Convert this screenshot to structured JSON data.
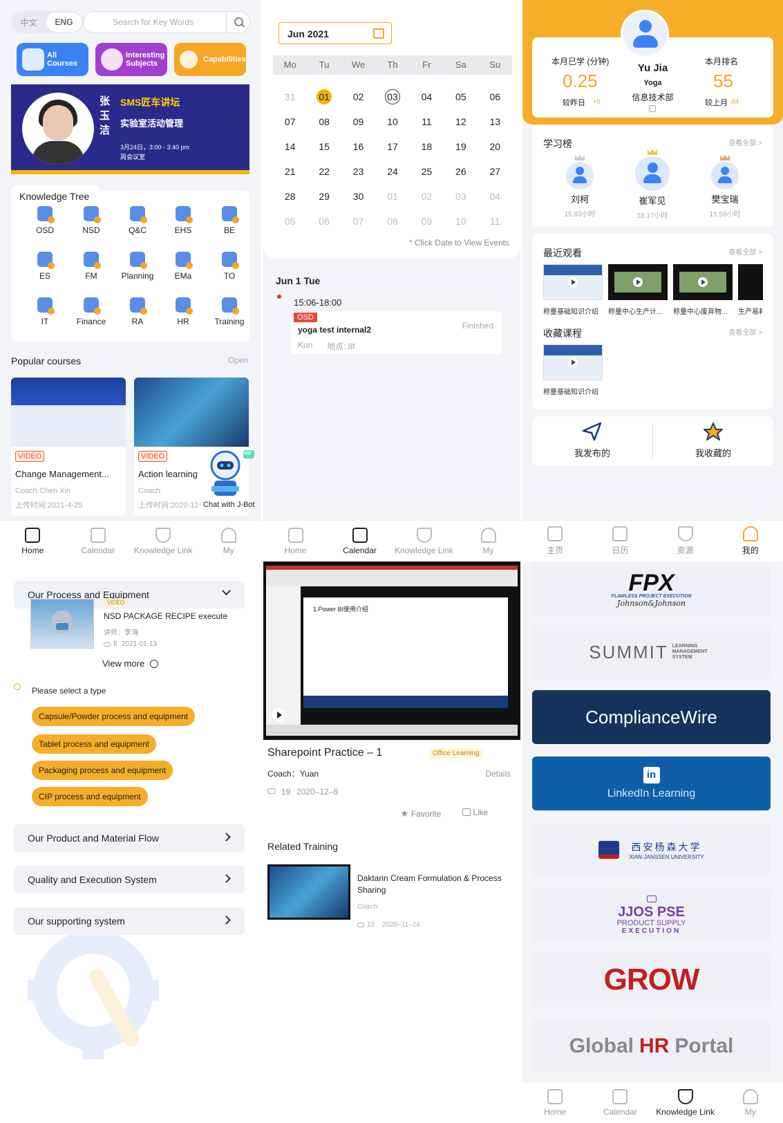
{
  "home": {
    "lang_cn": "中文",
    "lang_en": "ENG",
    "search_placeholder": "Search for Key Words",
    "quick": [
      {
        "label": "All Courses",
        "color": "#3b82f6"
      },
      {
        "label": "Interesting Subjects",
        "color": "#a23fd0"
      },
      {
        "label": "Capabilities",
        "color": "#f5a623"
      }
    ],
    "banner": {
      "name": "张玉洁",
      "title": "SMS匠车讲坛",
      "subtitle": "实验室活动管理",
      "time": "3月24日，3:00 - 3:40 pm",
      "location": "周会议室"
    },
    "knowledge_tree_title": "Knowledge Tree",
    "knowledge_tree": [
      "OSD",
      "NSD",
      "Q&C",
      "EHS",
      "BE",
      "ES",
      "FM",
      "Planning",
      "EMa",
      "TO",
      "IT",
      "Finance",
      "RA",
      "HR",
      "Training"
    ],
    "popular_title": "Popular courses",
    "popular_open": "Open",
    "courses": [
      {
        "tag": "VIDEO",
        "title": "Change Management...",
        "coach": "Coach:Chen Xin",
        "date": "上传时间:2021-4-29"
      },
      {
        "tag": "VIDEO",
        "title": "Action learning",
        "coach": "Coach:",
        "date": "上传时间:2020-12-"
      }
    ],
    "bot_bubble": "Hi!",
    "bot_label": "Chat with J-Bot",
    "tabs": [
      "Home",
      "Calendar",
      "Knowledge Link",
      "My"
    ]
  },
  "calendar": {
    "month": "Jun  2021",
    "weekdays": [
      "Mo",
      "Tu",
      "We",
      "Th",
      "Fr",
      "Sa",
      "Su"
    ],
    "rows": [
      [
        "31",
        "01",
        "02",
        "03",
        "04",
        "05",
        "06"
      ],
      [
        "07",
        "08",
        "09",
        "10",
        "11",
        "12",
        "13"
      ],
      [
        "14",
        "15",
        "16",
        "17",
        "18",
        "19",
        "20"
      ],
      [
        "21",
        "22",
        "23",
        "24",
        "25",
        "26",
        "27"
      ],
      [
        "28",
        "29",
        "30",
        "01",
        "02",
        "03",
        "04"
      ],
      [
        "05",
        "06",
        "07",
        "08",
        "09",
        "10",
        "11"
      ]
    ],
    "hint": "* Click Date to View Events",
    "day_title": "Jun 1 Tue",
    "event_time": "15:06-18:00",
    "event_tag": "OSD",
    "event_title": "yoga test internal2",
    "event_status": "Finished",
    "event_person": "Kun",
    "event_location": "地点: 8f",
    "tabs": [
      "Home",
      "Calendar",
      "Knowledge Link",
      "My"
    ]
  },
  "profile": {
    "studied_label": "本月已学 (分钟)",
    "studied_value": "0.25",
    "studied_delta_label": "较昨日",
    "studied_delta": "+0",
    "name": "Yu Jia",
    "dept_en": "Yoga",
    "dept_cn": "信息技术部",
    "rank_label": "本月排名",
    "rank_value": "55",
    "rank_delta_label": "较上月",
    "rank_delta": "-84",
    "leaderboard_title": "学习榜",
    "view_all": "查看全部 >",
    "leaders": [
      {
        "name": "刘柯",
        "hours": "15.83小时"
      },
      {
        "name": "崔军见",
        "hours": "18.17小时"
      },
      {
        "name": "樊宝瑞",
        "hours": "15.59小时"
      }
    ],
    "recent_title": "最近观看",
    "recent": [
      "称量基础知识介绍",
      "称量中心生产计...",
      "称量中心废弃物...",
      "生产易耗"
    ],
    "fav_title": "收藏课程",
    "fav": [
      "称量基础知识介绍"
    ],
    "published": "我发布的",
    "favorited": "我收藏的",
    "tabs": [
      "主页",
      "日历",
      "资源",
      "我的"
    ]
  },
  "process": {
    "section1": "Our Process and Equipment",
    "video_tag": "VIDEO",
    "video_title": "NSD PACKAGE RECIPE execute",
    "video_lecturer": "讲师：李海",
    "video_views": "8",
    "video_date": "2021-01-13",
    "view_more": "View more",
    "select_type": "Please select a type",
    "types": [
      "Capsule/Powder process and equipment",
      "Tablet process and equipment",
      "Packaging process and equipment",
      "CIP process and equipment"
    ],
    "sections": [
      "Our Product and Material Flow",
      "Quality and Execution System",
      "Our supporting system"
    ]
  },
  "detail": {
    "slide_title": "1.Power BI使用介绍",
    "title": "Sharepoint Practice – 1",
    "badge": "Office Learning",
    "coach": "Coach：Yuan",
    "details": "Details",
    "views": "19",
    "date": "2020–12–6",
    "favorite": "Favorite",
    "like": "Like",
    "related_title": "Related Training",
    "related_name": "Daktarin Cream Formulation & Process Sharing",
    "related_coach": "Coach:",
    "related_views": "12",
    "related_date": "2020–11–24"
  },
  "links": {
    "fpx": "FPX",
    "fpx_sub": "FLAWLESS PROJECT EXECUTION",
    "jnj": "Johnson&Johnson",
    "summit": "SUMMIT",
    "summit_sub": "LEARNING MANAGEMENT SYSTEM",
    "compliance": "ComplianceWire",
    "linkedin": "LinkedIn Learning",
    "xju_cn": "西安杨森大学",
    "xju_en": "XIAN-JANSSEN UNIVERSITY",
    "jjos": "JJOS PSE",
    "jjos_sub1": "PRODUCT SUPPLY",
    "jjos_sub2": "EXECUTION",
    "grow": "GROW",
    "hr_global": "Global",
    "hr_hr": "HR",
    "hr_portal": "Portal",
    "tabs": [
      "Home",
      "Calendar",
      "Knowledge Link",
      "My"
    ],
    "colors": {
      "compliance_bg": "#15335a",
      "linkedin_bg": "#0f5fa8",
      "grow_red": "#c41e1e",
      "jjos_purple": "#7a3fa0"
    }
  }
}
